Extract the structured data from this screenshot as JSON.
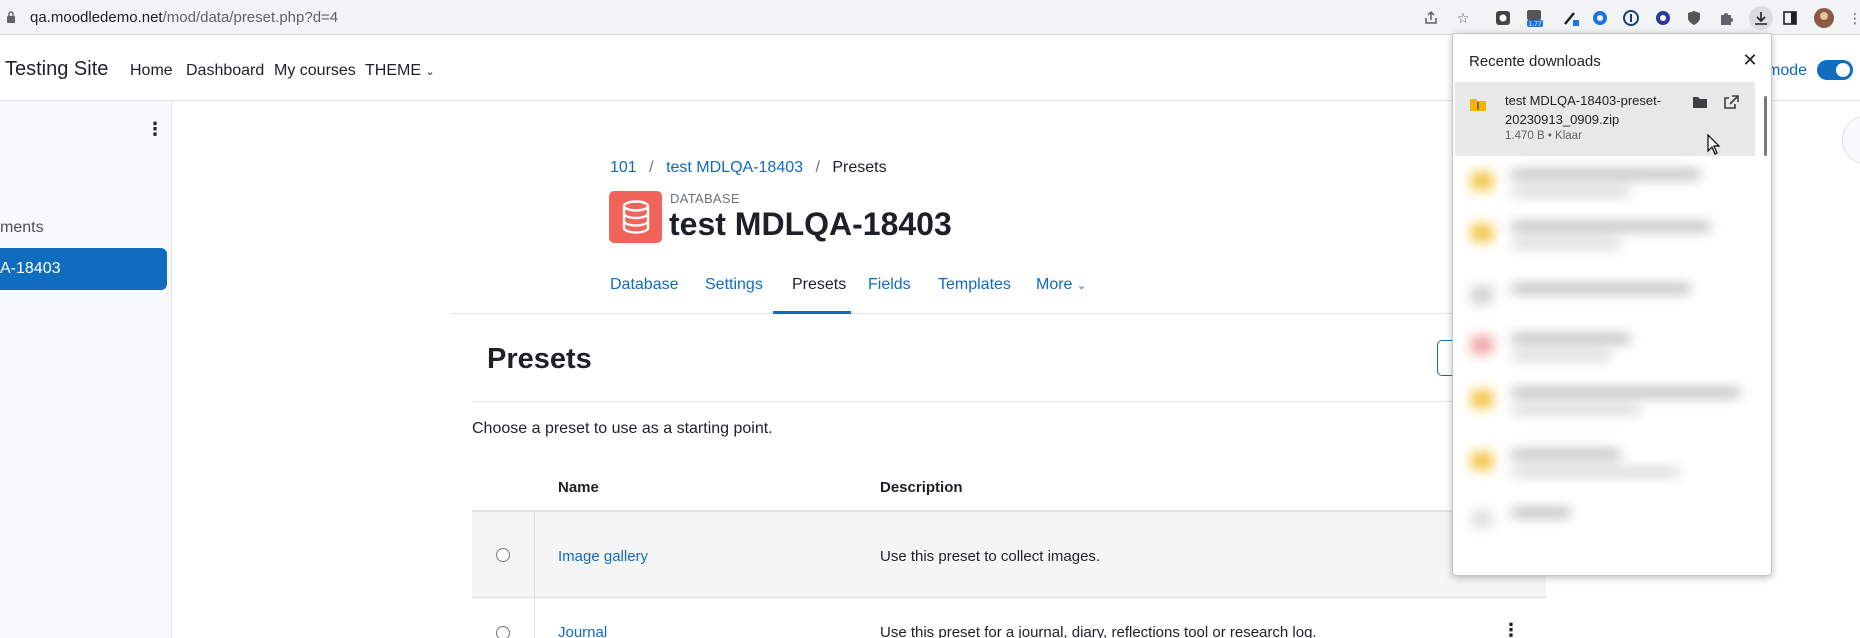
{
  "browser": {
    "url_host": "qa.moodledemo.net",
    "url_path": "/mod/data/preset.php?d=4",
    "extension_badge": "1.77",
    "icons": [
      "lock-icon",
      "share-icon",
      "star-icon",
      "extension-icon",
      "puzzle-icon",
      "download-icon",
      "sidepanel-icon",
      "profile-avatar",
      "more-icon"
    ]
  },
  "navbar": {
    "site_name": "Testing Site",
    "links": [
      "Home",
      "Dashboard",
      "My courses",
      "THEME"
    ],
    "edit_mode_label": "mode"
  },
  "drawer": {
    "partial_item": "ments",
    "active_item": "A-18403"
  },
  "breadcrumb": [
    "101",
    "test MDLQA-18403",
    "Presets"
  ],
  "activity": {
    "kind": "DATABASE",
    "title": "test MDLQA-18403"
  },
  "tabs": [
    "Database",
    "Settings",
    "Presets",
    "Fields",
    "Templates",
    "More"
  ],
  "active_tab": "Presets",
  "page": {
    "heading": "Presets",
    "intro": "Choose a preset to use as a starting point."
  },
  "table": {
    "headers": [
      "Name",
      "Description"
    ],
    "rows": [
      {
        "name": "Image gallery",
        "description": "Use this preset to collect images."
      },
      {
        "name": "Journal",
        "description": "Use this preset for a journal, diary, reflections tool or research log."
      }
    ]
  },
  "downloads": {
    "title": "Recente downloads",
    "item": {
      "file_name": "test MDLQA-18403-preset-20230913_0909.zip",
      "size_status": "1.470 B • Klaar"
    }
  },
  "colors": {
    "accent": "#0f6cbf",
    "db_icon": "#f0645a"
  }
}
